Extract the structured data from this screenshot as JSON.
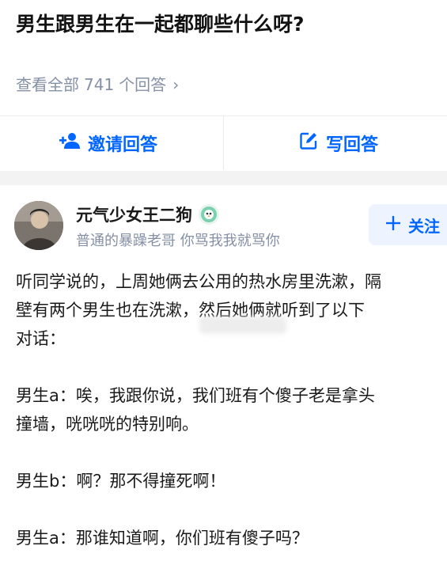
{
  "question": {
    "title": "男生跟男生在一起都聊些什么呀?"
  },
  "answers_link": {
    "prefix": "查看全部",
    "count": "741",
    "suffix": "个回答"
  },
  "actions": {
    "invite_label": "邀请回答",
    "write_label": "写回答"
  },
  "answer": {
    "author_name": "元气少女王二狗",
    "author_bio": "普通的暴躁老哥 你骂我我就骂你",
    "follow_label": "关注",
    "paragraphs": [
      "听同学说的，上周她俩去公用的热水房里洗漱，隔",
      "壁有两个男生也在洗漱，然后她俩就听到了以下",
      "对话：",
      "",
      "男生a：唉，我跟你说，我们班有个傻子老是拿头",
      "撞墙，咣咣咣的特别响。",
      "",
      "男生b：啊？那不得撞死啊！",
      "",
      "男生a：那谁知道啊，你们班有傻子吗？"
    ]
  },
  "colors": {
    "accent": "#0066ff",
    "muted": "#8590a6",
    "band": "#f3f3f4"
  },
  "icons": {
    "invite": "add-user-icon",
    "write": "edit-icon",
    "follow": "plus-icon",
    "chevron": "chevron-right-icon",
    "badge": "verified-badge-icon"
  }
}
